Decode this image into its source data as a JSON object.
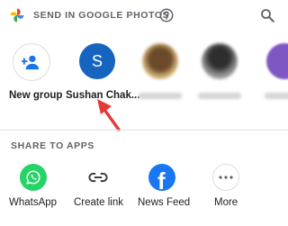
{
  "header": {
    "title": "SEND IN GOOGLE PHOTOS",
    "logo_icon": "google-photos-pinwheel-icon",
    "help_icon": "help-circle-icon",
    "search_icon": "search-icon"
  },
  "contacts": [
    {
      "label": "New group",
      "icon": "add-group-icon"
    },
    {
      "label": "Sushan Chak...",
      "initial": "S",
      "avatar_color": "#1565c0"
    },
    {
      "label": "",
      "blurred": true
    },
    {
      "label": "",
      "blurred": true
    },
    {
      "label": "",
      "blurred": true
    }
  ],
  "apps_section": {
    "title": "SHARE TO APPS",
    "apps": [
      {
        "label": "WhatsApp",
        "icon": "whatsapp-icon",
        "color": "#25d366"
      },
      {
        "label": "Create link",
        "icon": "link-icon"
      },
      {
        "label": "News Feed",
        "icon": "facebook-icon",
        "color": "#1877f2"
      },
      {
        "label": "More",
        "icon": "more-horizontal-icon"
      }
    ]
  },
  "annotation": {
    "arrow_color": "#e53935"
  }
}
